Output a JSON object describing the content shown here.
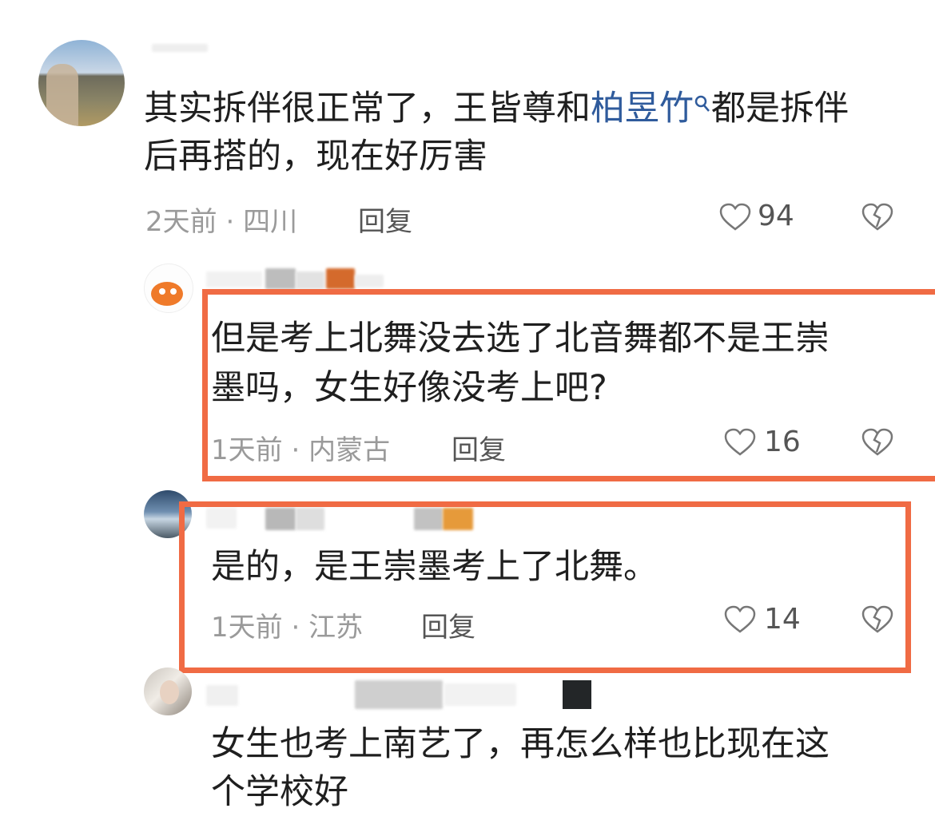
{
  "comments": [
    {
      "text_before": "其实拆伴很正常了，王皆尊和",
      "mention": "柏昱竹",
      "text_after_line1": "都是拆伴",
      "line2": "后再搭的，现在好厉害",
      "time": "2天前",
      "location": "四川",
      "reply_label": "回复",
      "likes": "94"
    },
    {
      "line1": "但是考上北舞没去选了北音舞都不是王崇",
      "line2": "墨吗，女生好像没考上吧?",
      "time": "1天前",
      "location": "内蒙古",
      "reply_label": "回复",
      "likes": "16"
    },
    {
      "line1": "是的，是王崇墨考上了北舞。",
      "time": "1天前",
      "location": "江苏",
      "reply_label": "回复",
      "likes": "14"
    },
    {
      "line1": "女生也考上南艺了，再怎么样也比现在这",
      "line2": "个学校好"
    }
  ],
  "meta_separator": "·",
  "colors": {
    "highlight": "#f06b44",
    "mention": "#2f5b9c",
    "text": "#1f1f1f",
    "meta": "#9a9a9a"
  },
  "icons": [
    "heart-outline-icon",
    "dislike-broken-heart-icon",
    "search-icon"
  ]
}
